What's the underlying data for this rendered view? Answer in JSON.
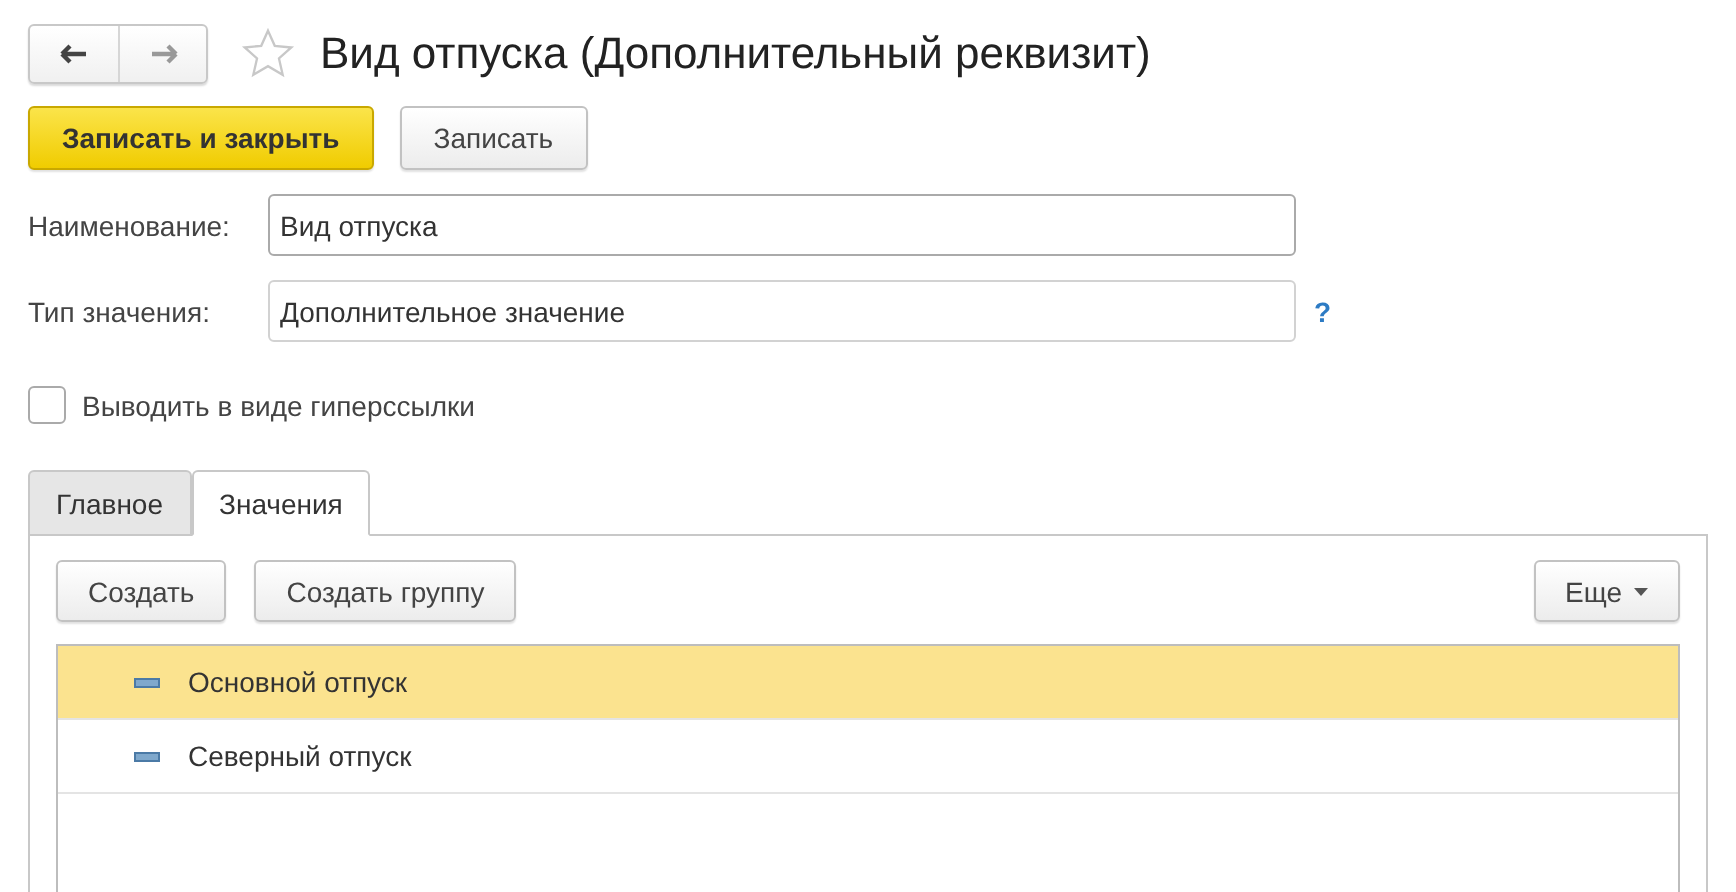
{
  "window": {
    "title": "Вид отпуска (Дополнительный реквизит)",
    "favorite": false
  },
  "toolbar": [
    "Записать и закрыть",
    "Записать"
  ],
  "fields": [
    {
      "label": "Наименование:",
      "value": "Вид отпуска"
    },
    {
      "label": "Тип значения:",
      "value": "Дополнительное значение",
      "help": "?"
    }
  ],
  "hyperlink_option": {
    "label": "Выводить в виде гиперссылки",
    "checked": false
  },
  "tabs": [
    {
      "label": "Главное",
      "selected": false
    },
    {
      "label": "Значения",
      "selected": true
    }
  ],
  "values_toolbar": {
    "buttons": [
      "Создать",
      "Создать группу"
    ],
    "more": "Еще"
  },
  "items": [
    {
      "label": "Основной отпуск",
      "selected": true
    },
    {
      "label": "Северный отпуск",
      "selected": false
    }
  ]
}
